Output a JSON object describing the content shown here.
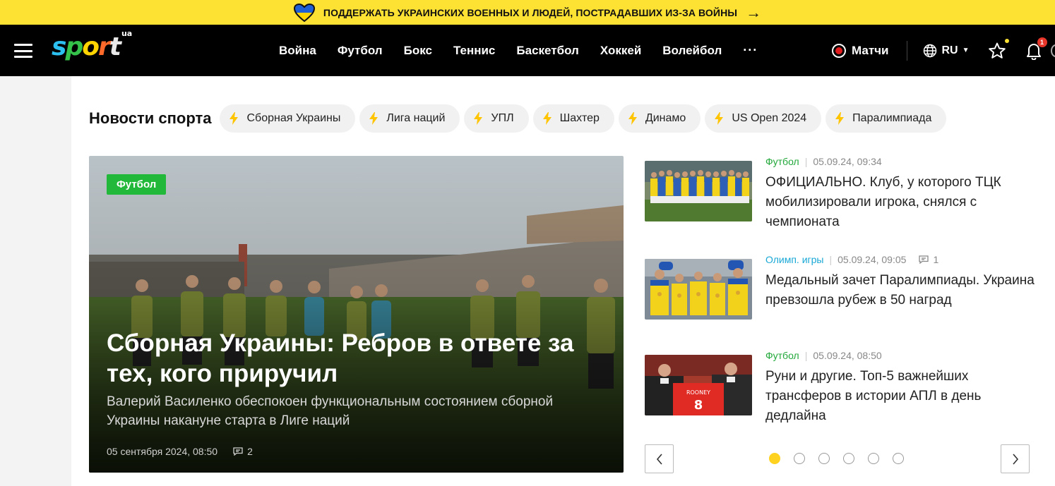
{
  "banner": {
    "text": "ПОДДЕРЖАТЬ УКРАИНСКИХ ВОЕННЫХ И ЛЮДЕЙ, ПОСТРАДАВШИХ ИЗ-ЗА ВОЙНЫ",
    "arrow": "→",
    "colors": {
      "background": "#fde133",
      "heart_top": "#1f5fd6",
      "heart_bottom": "#ffd400"
    }
  },
  "header": {
    "logo": {
      "main": "sport",
      "suffix": "ua"
    },
    "nav": [
      "Война",
      "Футбол",
      "Бокс",
      "Теннис",
      "Баскетбол",
      "Хоккей",
      "Волейбол"
    ],
    "more": "···",
    "live_label": "Матчи",
    "language": "RU",
    "notifications_count": "1",
    "icons": [
      "menu-icon",
      "live-dot-icon",
      "globe-icon",
      "star-icon",
      "bell-icon"
    ]
  },
  "topics": {
    "title": "Новости спорта",
    "chips": [
      "Сборная Украины",
      "Лига наций",
      "УПЛ",
      "Шахтер",
      "Динамо",
      "US Open 2024",
      "Паралимпиада"
    ]
  },
  "hero": {
    "category": "Футбол",
    "title": "Сборная Украины: Ребров в ответе за тех, кого приручил",
    "subtitle": "Валерий Василенко обеспокоен функциональным состоянием сборной Украины накануне старта в Лиге наций",
    "date": "05 сентября 2024, 08:50",
    "comments": "2"
  },
  "news": [
    {
      "category": "Футбол",
      "date": "05.09.24, 09:34",
      "comments": "",
      "title": "ОФИЦИАЛЬНО. Клуб, у которого ТЦК мобилизировали игрока, снялся с чемпионата"
    },
    {
      "category": "Олимп. игры",
      "date": "05.09.24, 09:05",
      "comments": "1",
      "title": "Медальный зачет Паралимпиады. Украина превзошла рубеж в 50 наград"
    },
    {
      "category": "Футбол",
      "date": "05.09.24, 08:50",
      "comments": "",
      "title": "Руни и другие. Топ-5 важнейших трансферов в истории АПЛ в день дедлайна"
    }
  ],
  "carousel": {
    "pages": 6,
    "active": 1
  },
  "colors": {
    "accent_yellow": "#ffd21f",
    "green": "#22b83a",
    "blue_category": "#19a8d6",
    "header_bg": "#000000"
  }
}
